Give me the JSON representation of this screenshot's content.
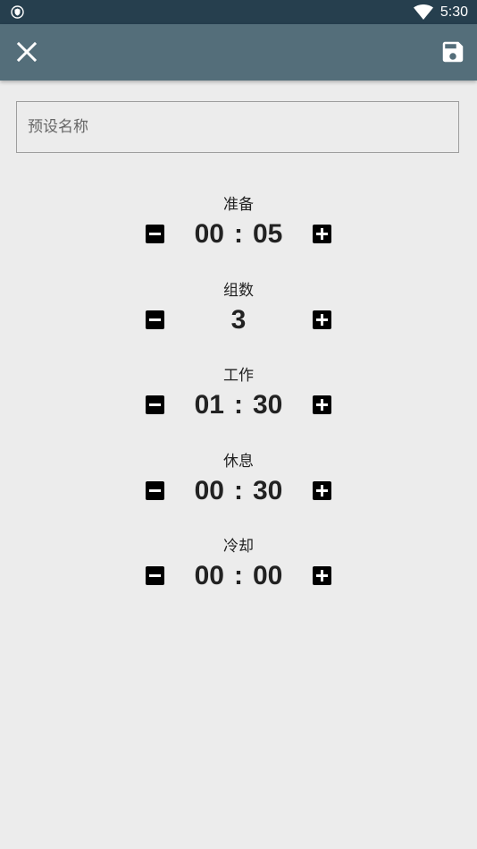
{
  "status_bar": {
    "time": "5:30",
    "left_icon": "shield-icon",
    "wifi_icon": "wifi-icon"
  },
  "toolbar": {
    "close_icon": "close-icon",
    "save_icon": "floppy-disk-icon",
    "background_color": "#546e7a",
    "status_bar_color": "#263f4e"
  },
  "preset_name": {
    "placeholder": "预设名称",
    "value": ""
  },
  "timers": {
    "prepare": {
      "label": "准备",
      "minutes": "00",
      "separator": ":",
      "seconds": "05"
    },
    "sets": {
      "label": "组数",
      "value": "3"
    },
    "work": {
      "label": "工作",
      "minutes": "01",
      "separator": ":",
      "seconds": "30"
    },
    "rest": {
      "label": "休息",
      "minutes": "00",
      "separator": ":",
      "seconds": "30"
    },
    "cooldown": {
      "label": "冷却",
      "minutes": "00",
      "separator": ":",
      "seconds": "00"
    }
  },
  "icons": {
    "decrease": "minus-box-icon",
    "increase": "plus-box-icon"
  }
}
